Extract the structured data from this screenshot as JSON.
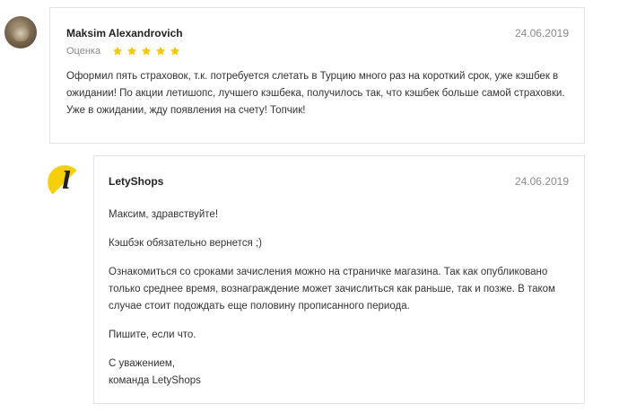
{
  "review": {
    "author": "Maksim Alexandrovich",
    "date": "24.06.2019",
    "rating_label": "Оценка",
    "rating": 5,
    "rating_max": 5,
    "star_color": "#f6c710",
    "text": "Оформил пять страховок, т.к. потребуется слетать в Турцию много раз на короткий срок, уже кэшбек в ожидании! По акции летишопс, лучшего кэшбека, получилось так, что кэшбек больше самой страховки. Уже в ожидании, жду появления на счету! Топчик!"
  },
  "reply": {
    "author": "LetyShops",
    "date": "24.06.2019",
    "logo_letter": "l",
    "brand_color": "#f6cf0c",
    "paragraphs": [
      "Максим, здравствуйте!",
      "Кэшбэк обязательно вернется ;)",
      "Ознакомиться со сроками зачисления можно на страничке магазина. Так как опубликовано только среднее время, вознаграждение может зачислиться как раньше, так и позже. В таком случае стоит подождать еще половину прописанного периода.",
      "Пишите, если что.",
      "С уважением,",
      "команда LetyShops"
    ]
  }
}
